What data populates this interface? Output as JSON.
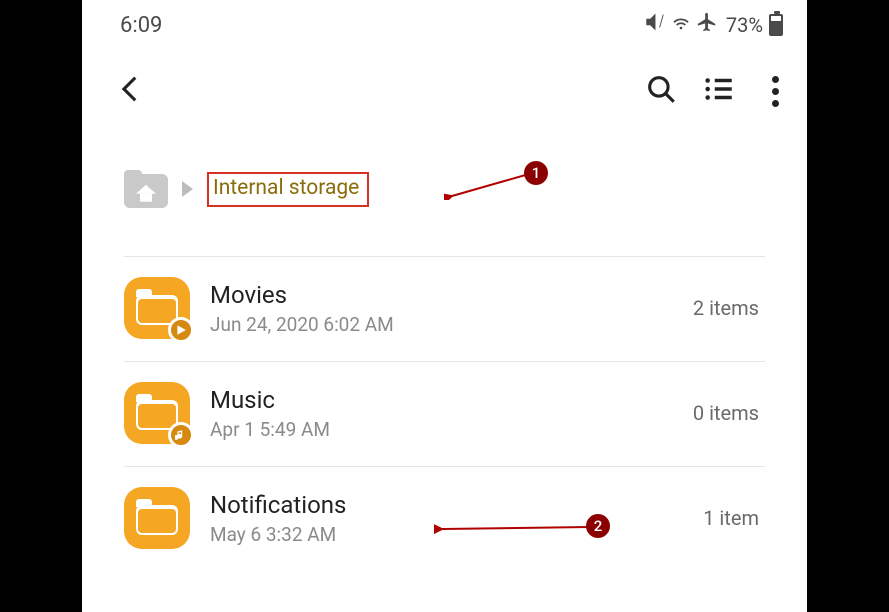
{
  "status": {
    "time": "6:09",
    "battery_percent": "73%"
  },
  "breadcrumb": {
    "current": "Internal storage"
  },
  "items": [
    {
      "name": "Movies",
      "date": "Jun 24, 2020 6:02 AM",
      "count": "2 items",
      "badge": "play"
    },
    {
      "name": "Music",
      "date": "Apr 1 5:49 AM",
      "count": "0 items",
      "badge": "music"
    },
    {
      "name": "Notifications",
      "date": "May 6 3:32 AM",
      "count": "1 item",
      "badge": "none"
    }
  ],
  "annotations": {
    "a1": "1",
    "a2": "2"
  }
}
